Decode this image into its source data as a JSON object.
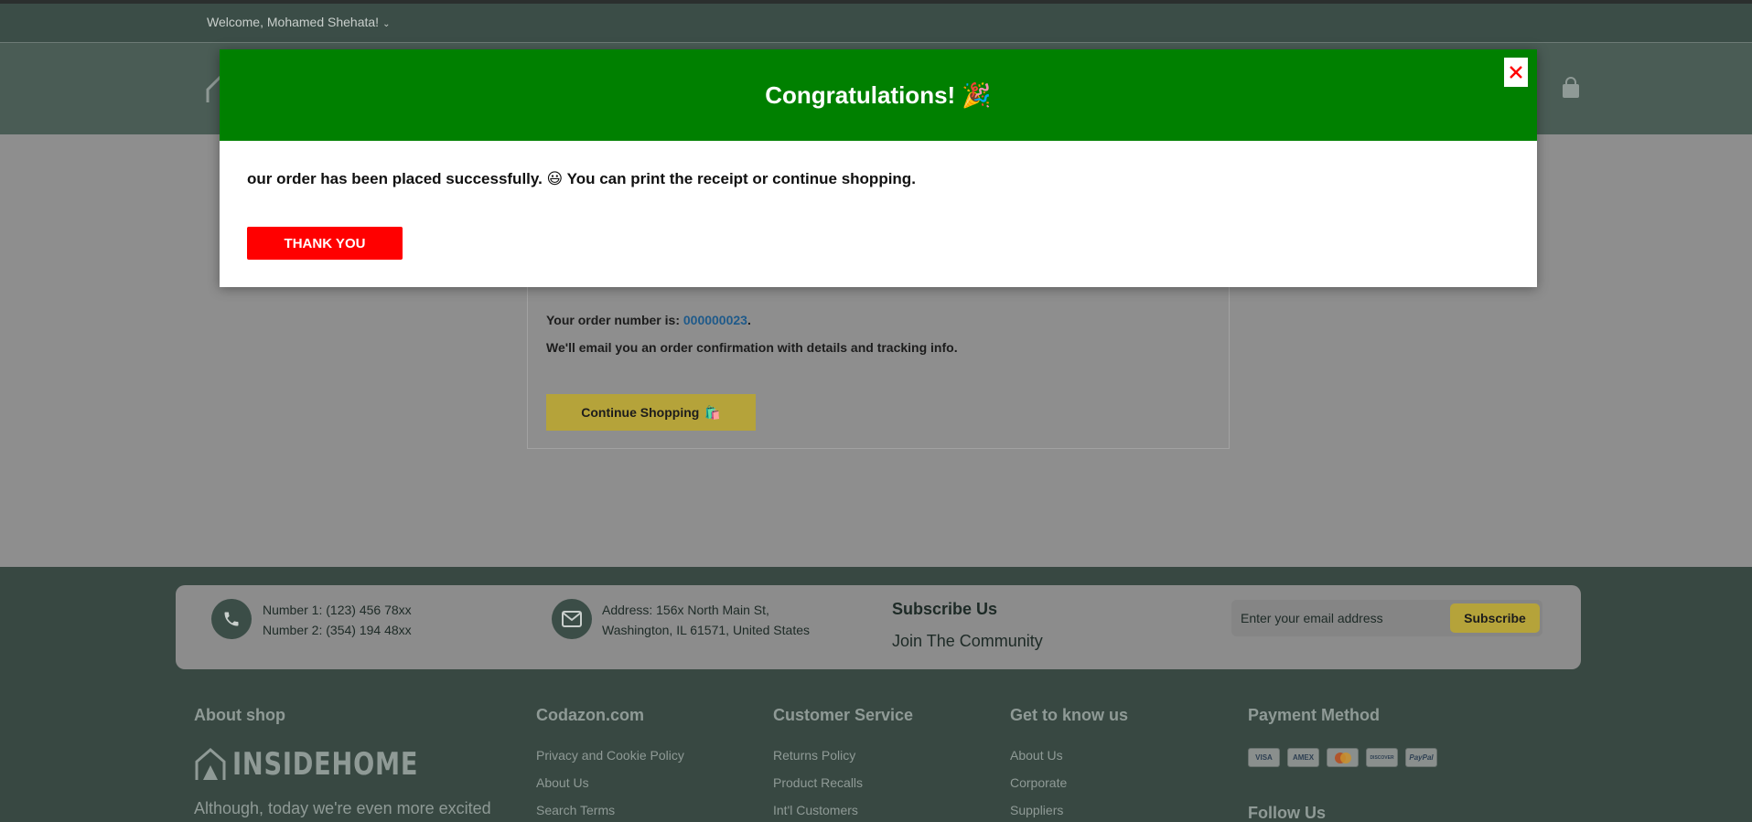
{
  "topbar": {
    "welcome_text": "Welcome, Mohamed Shehata!",
    "chevron": "⌄"
  },
  "order": {
    "number_prefix": "Your order number is: ",
    "number": "000000023",
    "number_suffix": ".",
    "email_note": "We'll email you an order confirmation with details and tracking info.",
    "continue_label": "Continue Shopping",
    "continue_emoji": "🛍️"
  },
  "modal": {
    "title": "Congratulations! 🎉",
    "message": "our order has been placed successfully. 😃 You can print the receipt or continue shopping.",
    "thankyou_label": "THANK YOU",
    "close_glyph": "✕"
  },
  "footer": {
    "phone": {
      "line1": "Number 1: (123) 456 78xx",
      "line2": "Number 2: (354) 194 48xx"
    },
    "address": {
      "line1": "Address: 156x North Main St,",
      "line2": "Washington, IL 61571, United States"
    },
    "subscribe": {
      "title": "Subscribe Us",
      "subtitle": "Join The Community",
      "placeholder": "Enter your email address",
      "button_label": "Subscribe"
    },
    "about": {
      "title": "About shop",
      "brand": "INSIDEHOME",
      "text": "Although, today we're even more excited"
    },
    "codazon": {
      "title": "Codazon.com",
      "links": [
        "Privacy and Cookie Policy",
        "About Us",
        "Search Terms"
      ]
    },
    "customer_service": {
      "title": "Customer Service",
      "links": [
        "Returns Policy",
        "Product Recalls",
        "Int'l Customers"
      ]
    },
    "get_to_know": {
      "title": "Get to know us",
      "links": [
        "About Us",
        "Corporate",
        "Suppliers"
      ]
    },
    "payment": {
      "title": "Payment Method",
      "cards": [
        "VISA",
        "AMEX",
        "MC",
        "DISCOVER",
        "PayPal"
      ]
    },
    "follow": {
      "title": "Follow Us"
    }
  },
  "colors": {
    "modal_header": "#008000",
    "thankyou": "#ff0000",
    "accent": "#b5a33a",
    "footer": "#384842"
  }
}
